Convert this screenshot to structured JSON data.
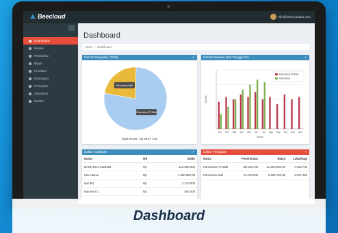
{
  "app": {
    "logo_text": "Beecloud",
    "user_email": "info@beecloudapp.com"
  },
  "sidebar": {
    "items": [
      {
        "label": "Dashboard",
        "active": true
      },
      {
        "label": "Master"
      },
      {
        "label": "Pembelian"
      },
      {
        "label": "Biaya"
      },
      {
        "label": "Produksi"
      },
      {
        "label": "Keuangan"
      },
      {
        "label": "Penjualan"
      },
      {
        "label": "Akuntansi"
      },
      {
        "label": "Master"
      }
    ]
  },
  "page": {
    "title": "Dashboard",
    "breadcrumb": [
      "Home",
      "Dashboard"
    ]
  },
  "pie_box": {
    "title": "Omzet Penjualan (Total)",
    "tools": "- ×",
    "footer": "Total Omzet : Rp 98.3T 1TD"
  },
  "bar_box": {
    "title": "Omzet Bulanan (Per Tanggal 31)",
    "tools": "- ×"
  },
  "table1": {
    "title": "Daftar Kas/Bank",
    "tools": "- ×",
    "headers": [
      "Nama",
      "Mtl",
      "Saldo"
    ],
    "rows": [
      [
        "BANK BCA 0123456",
        "Rp",
        "110.000.000"
      ],
      [
        "Kas Utama",
        "Rp",
        "1.650.862,00"
      ],
      [
        "Kas BG",
        "Rp",
        "2.210.000"
      ],
      [
        "Kas Kecil 1",
        "Rp",
        "500.000"
      ]
    ]
  },
  "table2": {
    "title": "Daftar Penjualan",
    "tools": "- ×",
    "headers": [
      "Nama",
      "Penerimaan",
      "Biaya",
      "Laba/Rugi"
    ],
    "rows": [
      [
        "Panorama PS Mall",
        "38.163.708",
        "31.150.000,00",
        "7.013.708"
      ],
      [
        "Panorama Mall",
        "11.232.000",
        "6.660.750,00",
        "4.571.250"
      ]
    ]
  },
  "chart_data": [
    {
      "type": "pie",
      "title": "Omzet Penjualan (Total)",
      "slices": [
        {
          "label": "Panorama PS Mall",
          "value": 0.775,
          "color": "#a9cdf0"
        },
        {
          "label": "Panorama Mall",
          "value": 0.225,
          "color": "#e9b93a"
        }
      ]
    },
    {
      "type": "bar",
      "title": "Omzet Bulanan (Per Tanggal 31)",
      "categories": [
        "Jan",
        "Feb",
        "Mar",
        "Apr",
        "Mei",
        "Jun",
        "Jul",
        "Ags",
        "Sep",
        "Okt",
        "Nov",
        "Des"
      ],
      "series": [
        {
          "name": "Panorama PS Mall",
          "color": "#b8384c",
          "values": [
            11,
            13,
            12,
            14,
            13,
            15,
            12,
            13,
            10,
            14,
            12,
            13
          ]
        },
        {
          "name": "Panorama",
          "color": "#7fb04a",
          "values": [
            6,
            9,
            12,
            16,
            18,
            20,
            19,
            0,
            0,
            0,
            0,
            0
          ]
        }
      ],
      "ylim": [
        0,
        24
      ],
      "xlabel": "Bulan",
      "ylabel": "Omzet",
      "grid": true,
      "legend": "top-right"
    }
  ],
  "caption": "Dashboard"
}
